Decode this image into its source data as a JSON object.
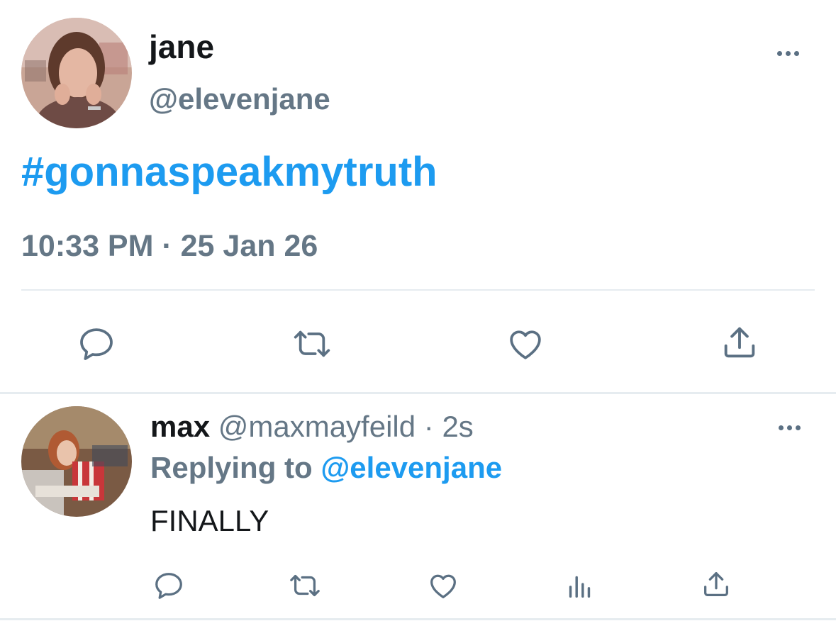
{
  "main_tweet": {
    "display_name": "jane",
    "handle": "@elevenjane",
    "text": "#gonnaspeakmytruth",
    "timestamp": "10:33 PM · 25 Jan 26",
    "actions": [
      "reply-icon",
      "retweet-icon",
      "like-icon",
      "share-icon"
    ]
  },
  "reply_tweet": {
    "display_name": "max",
    "handle": "@maxmayfeild",
    "separator": " · ",
    "time_ago": "2s",
    "replying_label": "Replying to",
    "replying_to": "@elevenjane",
    "text": "FINALLY",
    "actions": [
      "reply-icon",
      "retweet-icon",
      "like-icon",
      "analytics-icon",
      "share-icon"
    ]
  },
  "colors": {
    "accent": "#1d9bf0",
    "secondary_text": "#657786",
    "icon": "#5b7083",
    "divider": "#e6ecf0"
  }
}
